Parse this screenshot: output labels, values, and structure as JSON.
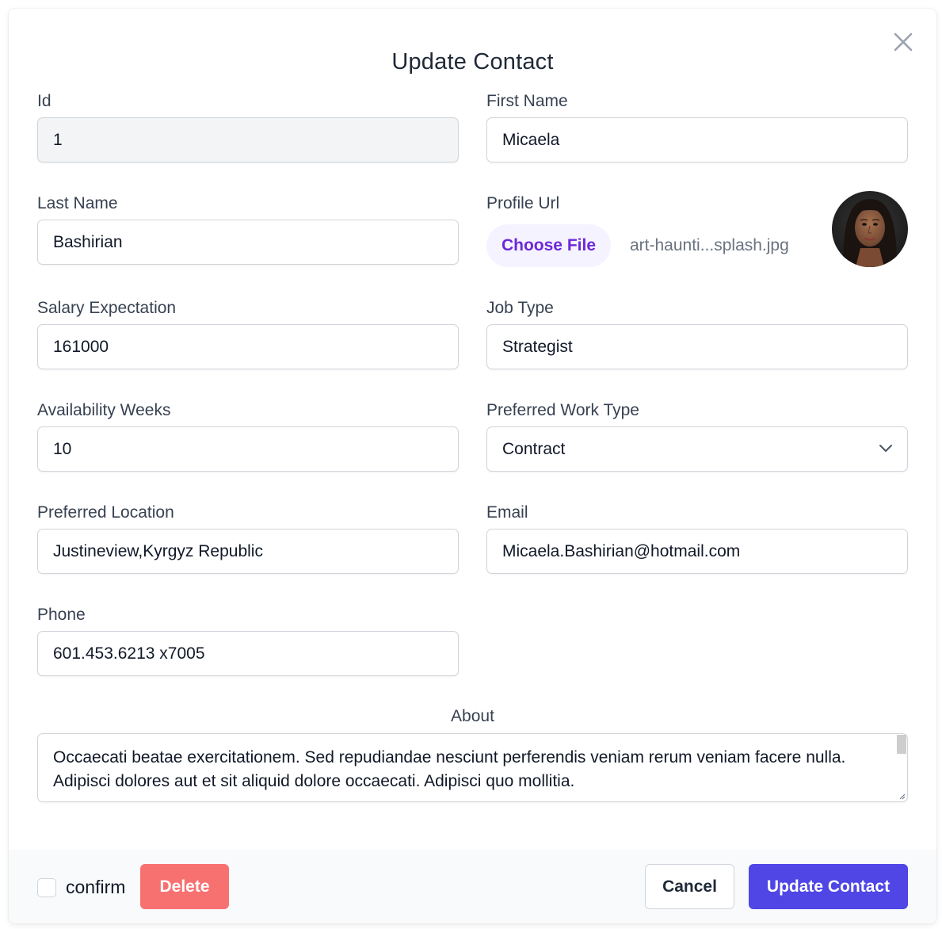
{
  "dialog": {
    "title": "Update Contact",
    "close_icon": "close-icon"
  },
  "fields": {
    "id": {
      "label": "Id",
      "value": "1"
    },
    "first_name": {
      "label": "First Name",
      "value": "Micaela"
    },
    "last_name": {
      "label": "Last Name",
      "value": "Bashirian"
    },
    "profile_url": {
      "label": "Profile Url",
      "button_label": "Choose File",
      "file_name": "art-haunti...splash.jpg"
    },
    "salary_expectation": {
      "label": "Salary Expectation",
      "value": "161000"
    },
    "job_type": {
      "label": "Job Type",
      "value": "Strategist"
    },
    "availability_weeks": {
      "label": "Availability Weeks",
      "value": "10"
    },
    "preferred_work_type": {
      "label": "Preferred Work Type",
      "value": "Contract",
      "icon": "chevron-down-icon"
    },
    "preferred_location": {
      "label": "Preferred Location",
      "value": "Justineview,Kyrgyz Republic"
    },
    "email": {
      "label": "Email",
      "value": "Micaela.Bashirian@hotmail.com"
    },
    "phone": {
      "label": "Phone",
      "value": "601.453.6213 x7005"
    },
    "about": {
      "label": "About",
      "value": "Occaecati beatae exercitationem. Sed repudiandae nesciunt perferendis veniam rerum veniam facere nulla. Adipisci dolores aut et sit aliquid dolore occaecati. Adipisci quo mollitia."
    }
  },
  "footer": {
    "confirm_label": "confirm",
    "confirm_checked": false,
    "delete_label": "Delete",
    "cancel_label": "Cancel",
    "update_label": "Update Contact"
  },
  "colors": {
    "primary": "#4f46e5",
    "danger": "#f87171",
    "file_button_bg": "#f5f3ff",
    "file_button_text": "#6d28d9",
    "disabled_input_bg": "#f3f4f6"
  }
}
